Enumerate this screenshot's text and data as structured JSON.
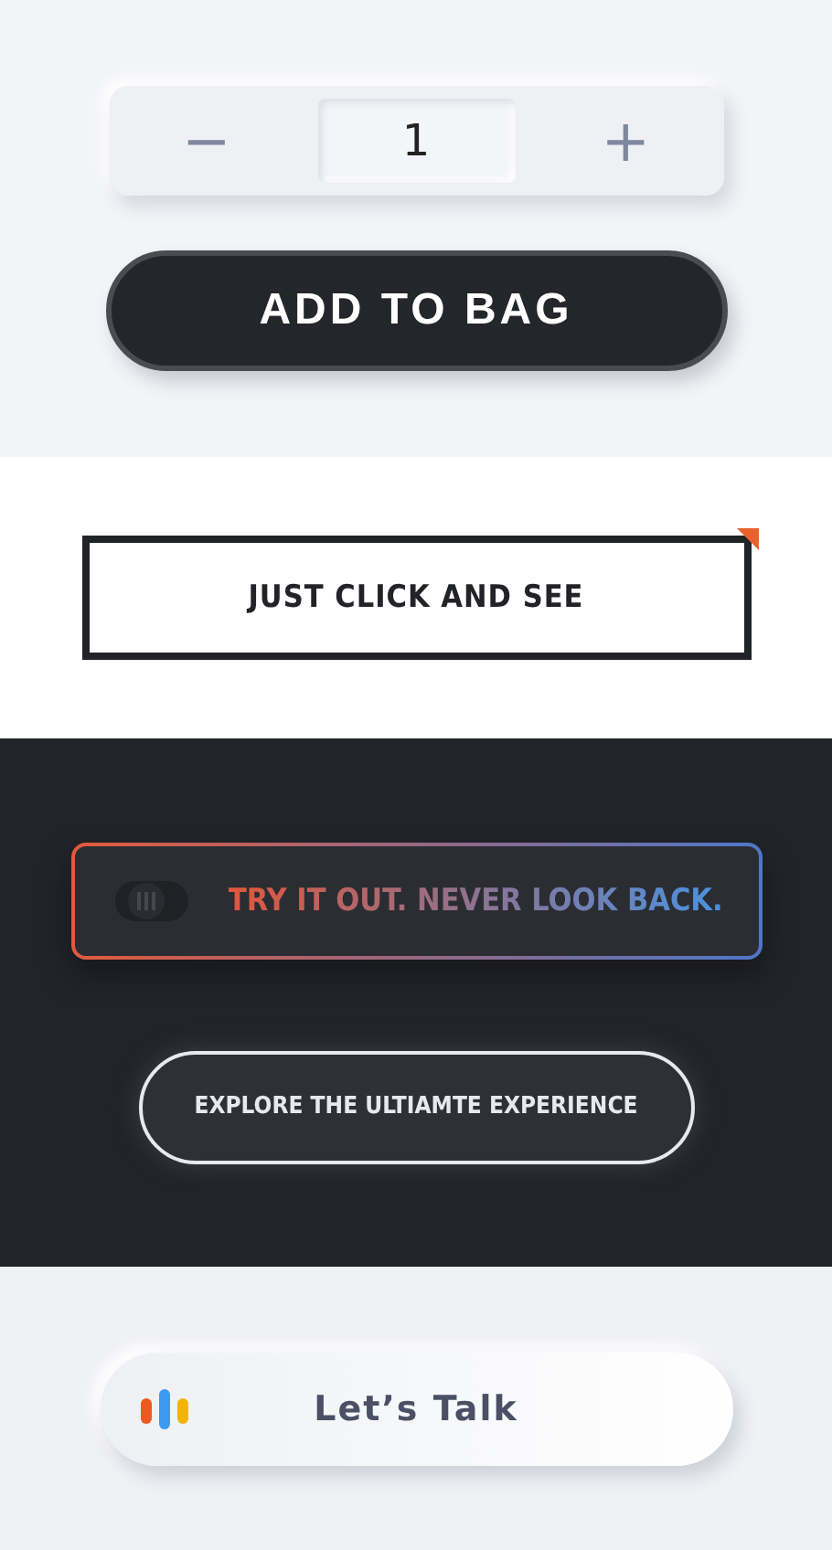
{
  "quantity_stepper": {
    "decrement": "−",
    "value": "1",
    "increment": "+"
  },
  "add_to_bag_button": {
    "label": "ADD TO BAG"
  },
  "just_click_button": {
    "label": "JUST CLICK AND SEE"
  },
  "try_it_out_button": {
    "label": "TRY IT OUT. NEVER LOOK BACK."
  },
  "explore_button": {
    "label": "EXPLORE THE ULTIAMTE EXPERIENCE"
  },
  "lets_talk_button": {
    "label": "Let’s Talk"
  }
}
